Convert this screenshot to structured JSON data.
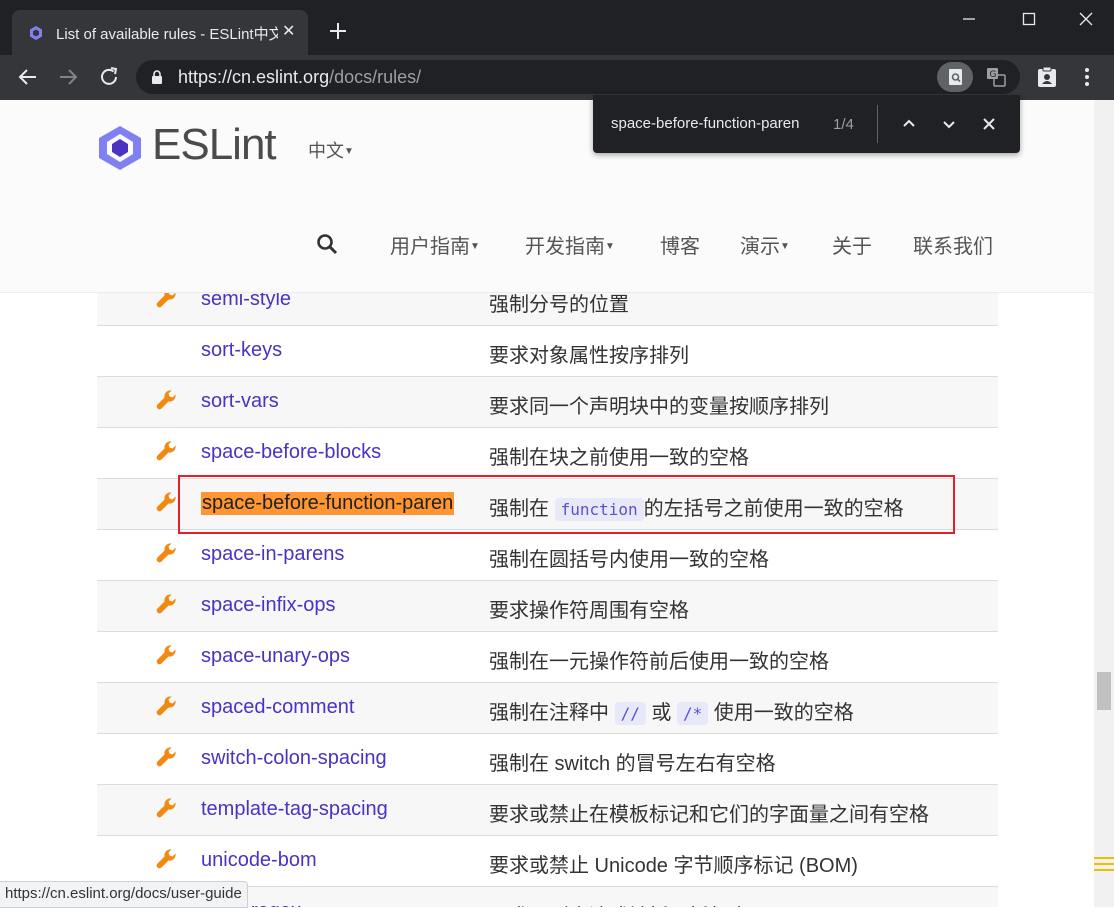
{
  "browser": {
    "tab_title": "List of available rules - ESLint中文",
    "tab_close": "✕",
    "url_host": "https://cn.eslint.org",
    "url_path": "/docs/rules/",
    "find": {
      "query": "space-before-function-paren",
      "count": "1/4"
    },
    "status_url": "https://cn.eslint.org/docs/user-guide"
  },
  "site": {
    "logo": "ESLint",
    "lang": "中文",
    "nav": [
      "用户指南",
      "开发指南",
      "博客",
      "演示",
      "关于",
      "联系我们"
    ]
  },
  "rules": [
    {
      "name": "semi-style",
      "fixable": true,
      "desc": "强制分号的位置"
    },
    {
      "name": "sort-keys",
      "fixable": false,
      "desc": "要求对象属性按序排列"
    },
    {
      "name": "sort-vars",
      "fixable": true,
      "desc": "要求同一个声明块中的变量按顺序排列"
    },
    {
      "name": "space-before-blocks",
      "fixable": true,
      "desc": "强制在块之前使用一致的空格"
    },
    {
      "name": "space-before-function-paren",
      "fixable": true,
      "highlight": true,
      "desc_pre": "强制在",
      "desc_code": "function",
      "desc_post": "的左括号之前使用一致的空格"
    },
    {
      "name": "space-in-parens",
      "fixable": true,
      "desc": "强制在圆括号内使用一致的空格"
    },
    {
      "name": "space-infix-ops",
      "fixable": true,
      "desc": "要求操作符周围有空格"
    },
    {
      "name": "space-unary-ops",
      "fixable": true,
      "desc": "强制在一元操作符前后使用一致的空格"
    },
    {
      "name": "spaced-comment",
      "fixable": true,
      "desc_pre": "强制在注释中",
      "desc_code": "//",
      "desc_mid": "或",
      "desc_code2": "/*",
      "desc_post": "使用一致的空格"
    },
    {
      "name": "switch-colon-spacing",
      "fixable": true,
      "desc": "强制在 switch 的冒号左右有空格"
    },
    {
      "name": "template-tag-spacing",
      "fixable": true,
      "desc": "要求或禁止在模板标记和它们的字面量之间有空格"
    },
    {
      "name": "unicode-bom",
      "fixable": true,
      "desc": "要求或禁止 Unicode 字节顺序标记 (BOM)"
    },
    {
      "name": "wrap-regex",
      "fixable": true,
      "desc": "要求正则表达式被括号括起来"
    }
  ],
  "colors": {
    "link": "#4b32c3",
    "wrench": "#f28a12",
    "find_highlight": "#ff9632",
    "annotation": "#e0202a"
  }
}
